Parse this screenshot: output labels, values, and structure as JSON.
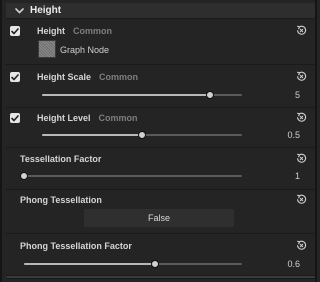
{
  "header": {
    "title": "Height",
    "chevron_icon": "chevron-down-icon"
  },
  "rows": {
    "height": {
      "label": "Height",
      "tag": "Common",
      "checked": true,
      "node_label": "Graph Node"
    },
    "height_scale": {
      "label": "Height Scale",
      "tag": "Common",
      "checked": true,
      "value": "5",
      "fraction": 0.84
    },
    "height_level": {
      "label": "Height Level",
      "tag": "Common",
      "checked": true,
      "value": "0.5",
      "fraction": 0.5
    },
    "tessellation_factor": {
      "label": "Tessellation Factor",
      "value": "1",
      "fraction": 0.0
    },
    "phong_tessellation": {
      "label": "Phong Tessellation",
      "value": "False"
    },
    "phong_tessellation_factor": {
      "label": "Phong Tessellation Factor",
      "value": "0.6",
      "fraction": 0.6
    }
  },
  "icons": {
    "reset": "reset-icon",
    "checkmark": "checkmark-icon"
  },
  "colors": {
    "background": "#242424",
    "checkbox": "#e6e6e6",
    "text": "#d8d8d8",
    "muted": "#7e7e7e"
  }
}
